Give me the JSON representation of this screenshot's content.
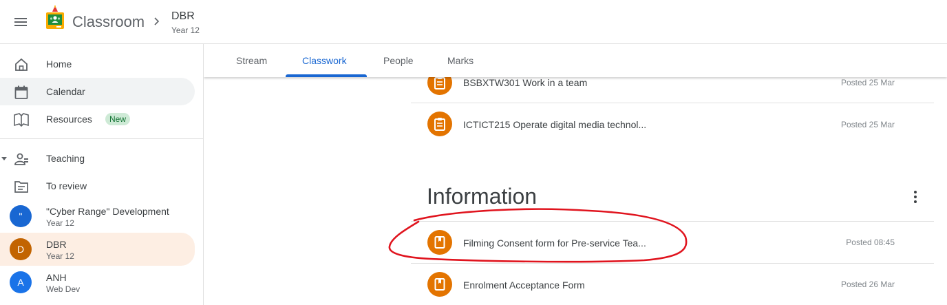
{
  "header": {
    "app_name": "Classroom",
    "class_name": "DBR",
    "class_section": "Year 12"
  },
  "sidebar": {
    "nav": [
      {
        "label": "Home",
        "icon": "home-icon"
      },
      {
        "label": "Calendar",
        "icon": "calendar-icon"
      },
      {
        "label": "Resources",
        "icon": "resources-icon",
        "badge": "New"
      }
    ],
    "teaching": {
      "label": "Teaching",
      "icon": "teaching-icon"
    },
    "to_review": {
      "label": "To review",
      "icon": "review-icon"
    },
    "classes": [
      {
        "initial": "\"",
        "title": "\"Cyber Range\" Development",
        "section": "Year 12",
        "color": "#1967d2"
      },
      {
        "initial": "D",
        "title": "DBR",
        "section": "Year 12",
        "color": "#c26401"
      },
      {
        "initial": "A",
        "title": "ANH",
        "section": "Web Dev",
        "color": "#1a73e8"
      }
    ]
  },
  "tabs": [
    {
      "label": "Stream"
    },
    {
      "label": "Classwork"
    },
    {
      "label": "People"
    },
    {
      "label": "Marks"
    }
  ],
  "active_tab": "Classwork",
  "classwork": {
    "items_above": [
      {
        "title": "BSBXTW301 Work in a team",
        "date": "Posted 25 Mar",
        "icon": "assignment-icon"
      },
      {
        "title": "ICTICT215 Operate digital media technol...",
        "date": "Posted 25 Mar",
        "icon": "assignment-icon"
      }
    ],
    "topic": {
      "title": "Information",
      "items": [
        {
          "title": "Filming Consent form for Pre-service Tea...",
          "date": "Posted 08:45",
          "icon": "material-icon"
        },
        {
          "title": "Enrolment Acceptance Form",
          "date": "Posted 26 Mar",
          "icon": "material-icon"
        }
      ]
    }
  },
  "colors": {
    "accent": "#1967d2",
    "item_icon": "#e37400",
    "annotation": "#e0141e",
    "selected_bg": "#fdeee3"
  }
}
